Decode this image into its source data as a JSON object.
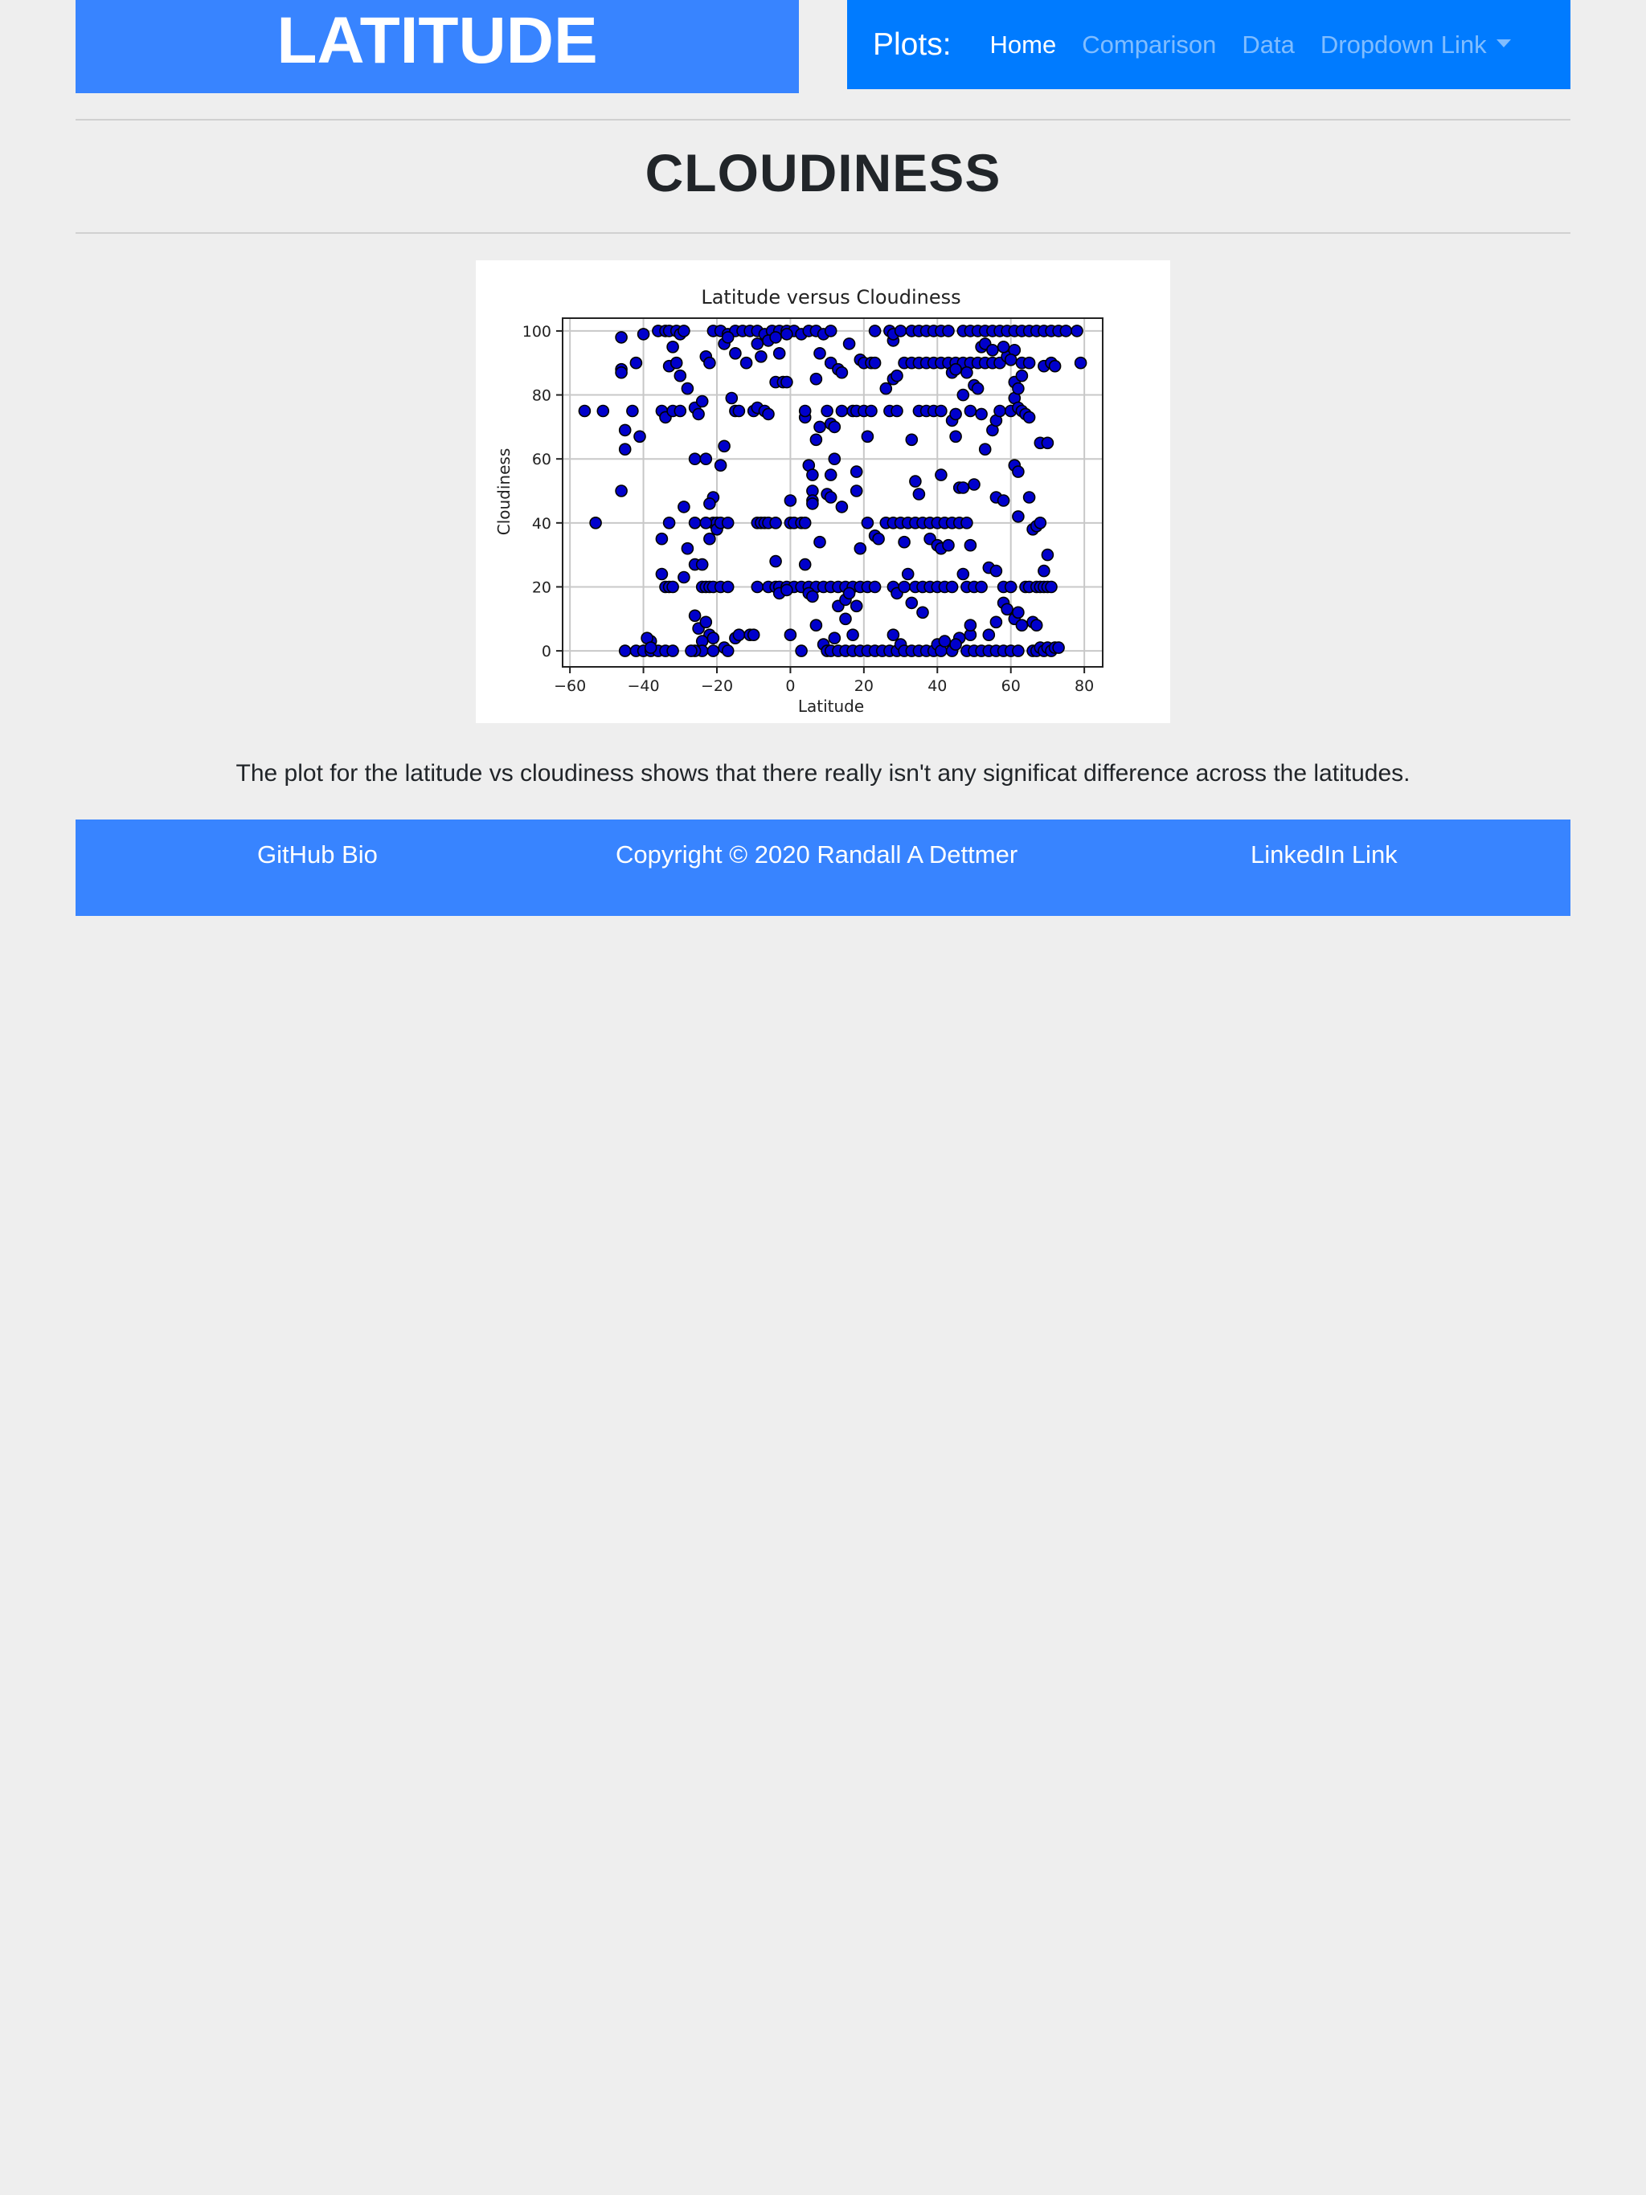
{
  "header": {
    "brand": "LATITUDE"
  },
  "nav": {
    "title": "Plots:",
    "links": [
      "Home",
      "Comparison",
      "Data",
      "Dropdown Link"
    ],
    "active": "Home"
  },
  "section": {
    "title": "CLOUDINESS"
  },
  "description": "The plot for the latitude vs cloudiness shows that there really isn't any significat difference across the latitudes.",
  "footer": {
    "left": "GitHub Bio",
    "center": "Copyright © 2020 Randall A Dettmer",
    "right": "LinkedIn Link"
  },
  "colors": {
    "background": "#eeeeee",
    "brand_blue": "#3884ff",
    "navbar_blue": "#007bff",
    "marker_fill": "#0000cc",
    "marker_edge": "#000000"
  },
  "chart_data": {
    "type": "scatter",
    "title": "Latitude versus Cloudiness",
    "xlabel": "Latitude",
    "ylabel": "Cloudiness",
    "xlim": [
      -62,
      85
    ],
    "ylim": [
      -5,
      104
    ],
    "xticks": [
      -60,
      -40,
      -20,
      0,
      20,
      40,
      60,
      80
    ],
    "yticks": [
      0,
      20,
      40,
      60,
      80,
      100
    ],
    "xtick_labels": [
      "−60",
      "−40",
      "−20",
      "0",
      "20",
      "40",
      "60",
      "80"
    ],
    "ytick_labels": [
      "0",
      "20",
      "40",
      "60",
      "80",
      "100"
    ],
    "grid": true,
    "points": [
      [
        -56,
        75
      ],
      [
        -53,
        40
      ],
      [
        -51,
        75
      ],
      [
        -46,
        98
      ],
      [
        -46,
        88
      ],
      [
        -46,
        87
      ],
      [
        -45,
        69
      ],
      [
        -45,
        63
      ],
      [
        -46,
        50
      ],
      [
        -43,
        75
      ],
      [
        -42,
        90
      ],
      [
        -41,
        67
      ],
      [
        -40,
        99
      ],
      [
        -45,
        0
      ],
      [
        -42,
        0
      ],
      [
        -40,
        0
      ],
      [
        -38,
        0
      ],
      [
        -38,
        3
      ],
      [
        -36,
        0
      ],
      [
        -34,
        0
      ],
      [
        -32,
        0
      ],
      [
        -39,
        4
      ],
      [
        -38,
        1
      ],
      [
        -36,
        100
      ],
      [
        -34,
        100
      ],
      [
        -33,
        100
      ],
      [
        -31,
        100
      ],
      [
        -30,
        99
      ],
      [
        -29,
        100
      ],
      [
        -32,
        95
      ],
      [
        -33,
        89
      ],
      [
        -31,
        90
      ],
      [
        -30,
        86
      ],
      [
        -28,
        82
      ],
      [
        -35,
        75
      ],
      [
        -34,
        73
      ],
      [
        -32,
        75
      ],
      [
        -30,
        75
      ],
      [
        -26,
        76
      ],
      [
        -25,
        74
      ],
      [
        -24,
        78
      ],
      [
        -23,
        92
      ],
      [
        -22,
        90
      ],
      [
        -35,
        24
      ],
      [
        -34,
        20
      ],
      [
        -33,
        20
      ],
      [
        -32,
        20
      ],
      [
        -35,
        35
      ],
      [
        -33,
        40
      ],
      [
        -29,
        45
      ],
      [
        -28,
        32
      ],
      [
        -29,
        23
      ],
      [
        -26,
        27
      ],
      [
        -24,
        27
      ],
      [
        -22,
        35
      ],
      [
        -21,
        40
      ],
      [
        -20,
        40
      ],
      [
        -21,
        48
      ],
      [
        -22,
        46
      ],
      [
        -26,
        60
      ],
      [
        -23,
        60
      ],
      [
        -19,
        58
      ],
      [
        -18,
        64
      ],
      [
        -26,
        40
      ],
      [
        -23,
        40
      ],
      [
        -20,
        38
      ],
      [
        -19,
        40
      ],
      [
        -17,
        40
      ],
      [
        -24,
        20
      ],
      [
        -23,
        20
      ],
      [
        -22,
        20
      ],
      [
        -21,
        20
      ],
      [
        -19,
        20
      ],
      [
        -17,
        20
      ],
      [
        -26,
        11
      ],
      [
        -25,
        7
      ],
      [
        -23,
        9
      ],
      [
        -22,
        5
      ],
      [
        -24,
        3
      ],
      [
        -21,
        4
      ],
      [
        -24,
        0
      ],
      [
        -26,
        0
      ],
      [
        -27,
        0
      ],
      [
        -21,
        0
      ],
      [
        -18,
        1
      ],
      [
        -17,
        0
      ],
      [
        -15,
        4
      ],
      [
        -14,
        5
      ],
      [
        -11,
        5
      ],
      [
        -10,
        5
      ],
      [
        -21,
        100
      ],
      [
        -19,
        100
      ],
      [
        -17,
        99
      ],
      [
        -15,
        100
      ],
      [
        -13,
        100
      ],
      [
        -11,
        100
      ],
      [
        -9,
        100
      ],
      [
        -7,
        99
      ],
      [
        -5,
        100
      ],
      [
        -3,
        100
      ],
      [
        -1,
        100
      ],
      [
        1,
        100
      ],
      [
        3,
        99
      ],
      [
        5,
        100
      ],
      [
        7,
        100
      ],
      [
        9,
        99
      ],
      [
        11,
        100
      ],
      [
        -18,
        96
      ],
      [
        -17,
        98
      ],
      [
        -15,
        93
      ],
      [
        -12,
        90
      ],
      [
        -9,
        96
      ],
      [
        -8,
        92
      ],
      [
        -6,
        97
      ],
      [
        -4,
        98
      ],
      [
        -3,
        93
      ],
      [
        -1,
        99
      ],
      [
        -16,
        79
      ],
      [
        -15,
        75
      ],
      [
        -14,
        75
      ],
      [
        -10,
        75
      ],
      [
        -9,
        76
      ],
      [
        -7,
        75
      ],
      [
        -6,
        74
      ],
      [
        -4,
        84
      ],
      [
        -2,
        84
      ],
      [
        -1,
        84
      ],
      [
        -9,
        40
      ],
      [
        -8,
        40
      ],
      [
        -7,
        40
      ],
      [
        -6,
        40
      ],
      [
        -4,
        40
      ],
      [
        0,
        47
      ],
      [
        0,
        40
      ],
      [
        1,
        40
      ],
      [
        3,
        40
      ],
      [
        4,
        40
      ],
      [
        -9,
        20
      ],
      [
        -6,
        20
      ],
      [
        -4,
        20
      ],
      [
        -3,
        20
      ],
      [
        -1,
        20
      ],
      [
        1,
        20
      ],
      [
        3,
        20
      ],
      [
        5,
        20
      ],
      [
        7,
        20
      ],
      [
        9,
        20
      ],
      [
        11,
        20
      ],
      [
        13,
        20
      ],
      [
        15,
        20
      ],
      [
        17,
        20
      ],
      [
        19,
        20
      ],
      [
        -4,
        28
      ],
      [
        -3,
        18
      ],
      [
        -1,
        19
      ],
      [
        4,
        27
      ],
      [
        5,
        18
      ],
      [
        6,
        17
      ],
      [
        13,
        14
      ],
      [
        15,
        16
      ],
      [
        16,
        18
      ],
      [
        18,
        14
      ],
      [
        19,
        32
      ],
      [
        0,
        5
      ],
      [
        3,
        0
      ],
      [
        7,
        8
      ],
      [
        9,
        2
      ],
      [
        10,
        0
      ],
      [
        12,
        4
      ],
      [
        11,
        0
      ],
      [
        13,
        0
      ],
      [
        15,
        0
      ],
      [
        17,
        0
      ],
      [
        15,
        10
      ],
      [
        17,
        5
      ],
      [
        19,
        0
      ],
      [
        21,
        0
      ],
      [
        23,
        0
      ],
      [
        25,
        0
      ],
      [
        27,
        0
      ],
      [
        29,
        0
      ],
      [
        4,
        73
      ],
      [
        4,
        75
      ],
      [
        7,
        66
      ],
      [
        8,
        70
      ],
      [
        10,
        75
      ],
      [
        11,
        71
      ],
      [
        12,
        70
      ],
      [
        14,
        75
      ],
      [
        17,
        75
      ],
      [
        18,
        75
      ],
      [
        20,
        75
      ],
      [
        22,
        75
      ],
      [
        21,
        67
      ],
      [
        5,
        58
      ],
      [
        6,
        55
      ],
      [
        6,
        50
      ],
      [
        6,
        47
      ],
      [
        6,
        46
      ],
      [
        8,
        34
      ],
      [
        10,
        49
      ],
      [
        11,
        48
      ],
      [
        12,
        60
      ],
      [
        11,
        55
      ],
      [
        14,
        45
      ],
      [
        18,
        56
      ],
      [
        18,
        50
      ],
      [
        7,
        85
      ],
      [
        8,
        93
      ],
      [
        11,
        90
      ],
      [
        13,
        88
      ],
      [
        14,
        87
      ],
      [
        16,
        96
      ],
      [
        19,
        91
      ],
      [
        20,
        90
      ],
      [
        22,
        90
      ],
      [
        23,
        90
      ],
      [
        21,
        40
      ],
      [
        23,
        36
      ],
      [
        24,
        35
      ],
      [
        26,
        40
      ],
      [
        28,
        40
      ],
      [
        30,
        40
      ],
      [
        32,
        40
      ],
      [
        34,
        40
      ],
      [
        36,
        40
      ],
      [
        38,
        40
      ],
      [
        40,
        40
      ],
      [
        42,
        40
      ],
      [
        44,
        40
      ],
      [
        46,
        40
      ],
      [
        48,
        40
      ],
      [
        34,
        53
      ],
      [
        35,
        49
      ],
      [
        31,
        34
      ],
      [
        38,
        35
      ],
      [
        40,
        33
      ],
      [
        41,
        32
      ],
      [
        41,
        55
      ],
      [
        43,
        33
      ],
      [
        46,
        51
      ],
      [
        47,
        51
      ],
      [
        50,
        52
      ],
      [
        21,
        20
      ],
      [
        23,
        20
      ],
      [
        28,
        20
      ],
      [
        29,
        18
      ],
      [
        31,
        20
      ],
      [
        34,
        20
      ],
      [
        36,
        20
      ],
      [
        38,
        20
      ],
      [
        40,
        20
      ],
      [
        42,
        20
      ],
      [
        44,
        20
      ],
      [
        48,
        20
      ],
      [
        50,
        20
      ],
      [
        52,
        20
      ],
      [
        32,
        24
      ],
      [
        33,
        15
      ],
      [
        36,
        12
      ],
      [
        47,
        24
      ],
      [
        49,
        33
      ],
      [
        54,
        26
      ],
      [
        56,
        25
      ],
      [
        28,
        5
      ],
      [
        30,
        2
      ],
      [
        31,
        0
      ],
      [
        33,
        0
      ],
      [
        35,
        0
      ],
      [
        37,
        0
      ],
      [
        39,
        0
      ],
      [
        40,
        2
      ],
      [
        41,
        0
      ],
      [
        42,
        3
      ],
      [
        44,
        0
      ],
      [
        46,
        4
      ],
      [
        48,
        0
      ],
      [
        50,
        0
      ],
      [
        52,
        0
      ],
      [
        54,
        0
      ],
      [
        56,
        0
      ],
      [
        58,
        0
      ],
      [
        60,
        0
      ],
      [
        62,
        0
      ],
      [
        45,
        2
      ],
      [
        49,
        5
      ],
      [
        49,
        8
      ],
      [
        54,
        5
      ],
      [
        56,
        9
      ],
      [
        58,
        15
      ],
      [
        59,
        13
      ],
      [
        61,
        10
      ],
      [
        62,
        12
      ],
      [
        63,
        8
      ],
      [
        66,
        9
      ],
      [
        67,
        8
      ],
      [
        23,
        100
      ],
      [
        27,
        100
      ],
      [
        28,
        97
      ],
      [
        28,
        99
      ],
      [
        30,
        100
      ],
      [
        33,
        100
      ],
      [
        35,
        100
      ],
      [
        37,
        100
      ],
      [
        39,
        100
      ],
      [
        41,
        100
      ],
      [
        43,
        100
      ],
      [
        47,
        100
      ],
      [
        49,
        100
      ],
      [
        51,
        100
      ],
      [
        53,
        100
      ],
      [
        55,
        100
      ],
      [
        57,
        100
      ],
      [
        59,
        100
      ],
      [
        61,
        100
      ],
      [
        63,
        100
      ],
      [
        65,
        100
      ],
      [
        67,
        100
      ],
      [
        69,
        100
      ],
      [
        71,
        100
      ],
      [
        73,
        100
      ],
      [
        75,
        100
      ],
      [
        78,
        100
      ],
      [
        26,
        82
      ],
      [
        28,
        85
      ],
      [
        29,
        86
      ],
      [
        31,
        90
      ],
      [
        33,
        90
      ],
      [
        35,
        90
      ],
      [
        37,
        90
      ],
      [
        39,
        90
      ],
      [
        41,
        90
      ],
      [
        43,
        90
      ],
      [
        45,
        90
      ],
      [
        47,
        90
      ],
      [
        49,
        90
      ],
      [
        51,
        90
      ],
      [
        53,
        90
      ],
      [
        55,
        90
      ],
      [
        57,
        90
      ],
      [
        59,
        92
      ],
      [
        61,
        94
      ],
      [
        63,
        90
      ],
      [
        65,
        90
      ],
      [
        69,
        89
      ],
      [
        71,
        90
      ],
      [
        72,
        89
      ],
      [
        79,
        90
      ],
      [
        27,
        75
      ],
      [
        29,
        75
      ],
      [
        33,
        66
      ],
      [
        35,
        75
      ],
      [
        37,
        75
      ],
      [
        39,
        75
      ],
      [
        41,
        75
      ],
      [
        44,
        72
      ],
      [
        45,
        74
      ],
      [
        45,
        67
      ],
      [
        47,
        80
      ],
      [
        49,
        75
      ],
      [
        50,
        83
      ],
      [
        51,
        82
      ],
      [
        52,
        74
      ],
      [
        53,
        63
      ],
      [
        55,
        69
      ],
      [
        56,
        72
      ],
      [
        57,
        75
      ],
      [
        60,
        75
      ],
      [
        61,
        79
      ],
      [
        62,
        76
      ],
      [
        63,
        75
      ],
      [
        64,
        74
      ],
      [
        65,
        73
      ],
      [
        44,
        87
      ],
      [
        45,
        88
      ],
      [
        48,
        87
      ],
      [
        52,
        95
      ],
      [
        53,
        96
      ],
      [
        55,
        94
      ],
      [
        58,
        95
      ],
      [
        60,
        91
      ],
      [
        61,
        84
      ],
      [
        62,
        82
      ],
      [
        63,
        86
      ],
      [
        56,
        48
      ],
      [
        58,
        47
      ],
      [
        61,
        58
      ],
      [
        62,
        56
      ],
      [
        62,
        42
      ],
      [
        65,
        48
      ],
      [
        66,
        38
      ],
      [
        67,
        39
      ],
      [
        68,
        40
      ],
      [
        58,
        20
      ],
      [
        60,
        20
      ],
      [
        64,
        20
      ],
      [
        65,
        20
      ],
      [
        67,
        20
      ],
      [
        68,
        20
      ],
      [
        69,
        20
      ],
      [
        70,
        20
      ],
      [
        71,
        20
      ],
      [
        68,
        65
      ],
      [
        70,
        65
      ],
      [
        69,
        25
      ],
      [
        70,
        30
      ],
      [
        66,
        0
      ],
      [
        67,
        0
      ],
      [
        68,
        1
      ],
      [
        69,
        0
      ],
      [
        70,
        1
      ],
      [
        71,
        0
      ],
      [
        72,
        1
      ],
      [
        73,
        1
      ]
    ]
  }
}
